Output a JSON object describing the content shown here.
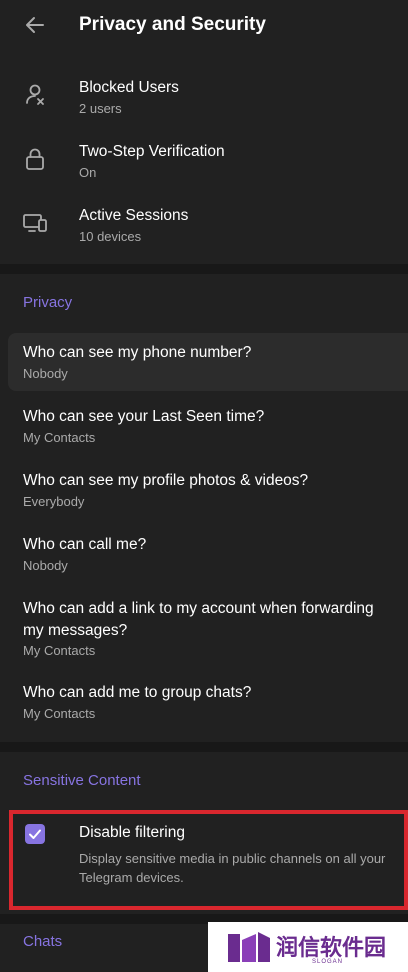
{
  "header": {
    "title": "Privacy and Security",
    "back_icon": "arrow-left-icon"
  },
  "security_items": [
    {
      "title": "Blocked Users",
      "subtitle": "2 users",
      "icon": "blocked-user-icon"
    },
    {
      "title": "Two-Step Verification",
      "subtitle": "On",
      "icon": "lock-icon"
    },
    {
      "title": "Active Sessions",
      "subtitle": "10 devices",
      "icon": "devices-icon"
    }
  ],
  "privacy": {
    "heading": "Privacy",
    "items": [
      {
        "title": "Who can see my phone number?",
        "value": "Nobody"
      },
      {
        "title": "Who can see your Last Seen time?",
        "value": "My Contacts"
      },
      {
        "title": "Who can see my profile photos & videos?",
        "value": "Everybody"
      },
      {
        "title": "Who can call me?",
        "value": "Nobody"
      },
      {
        "title": "Who can add a link to my account when forwarding my messages?",
        "value": "My Contacts"
      },
      {
        "title": "Who can add me to group chats?",
        "value": "My Contacts"
      }
    ]
  },
  "sensitive": {
    "heading": "Sensitive Content",
    "option": {
      "title": "Disable filtering",
      "description": "Display sensitive media in public channels on all your Telegram devices.",
      "checked": true
    }
  },
  "chats": {
    "heading": "Chats"
  },
  "watermark": {
    "text": "润信软件园",
    "sub": "SLOGAN"
  },
  "colors": {
    "accent": "#8774e1",
    "highlight_box": "#d9272e",
    "background": "#212121"
  }
}
